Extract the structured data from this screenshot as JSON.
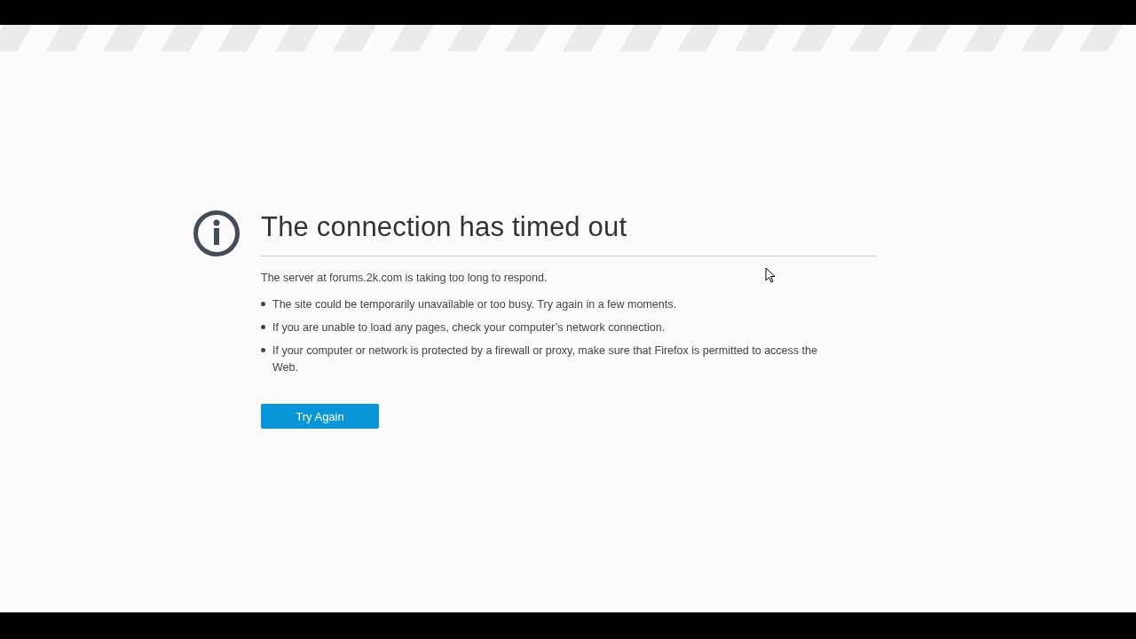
{
  "title": "The connection has timed out",
  "message": "The server at forums.2k.com is taking too long to respond.",
  "bullets": [
    "The site could be temporarily unavailable or too busy. Try again in a few moments.",
    "If you are unable to load any pages, check your computer’s network connection.",
    "If your computer or network is protected by a firewall or proxy, make sure that Firefox is permitted to access the Web."
  ],
  "button": "Try Again"
}
